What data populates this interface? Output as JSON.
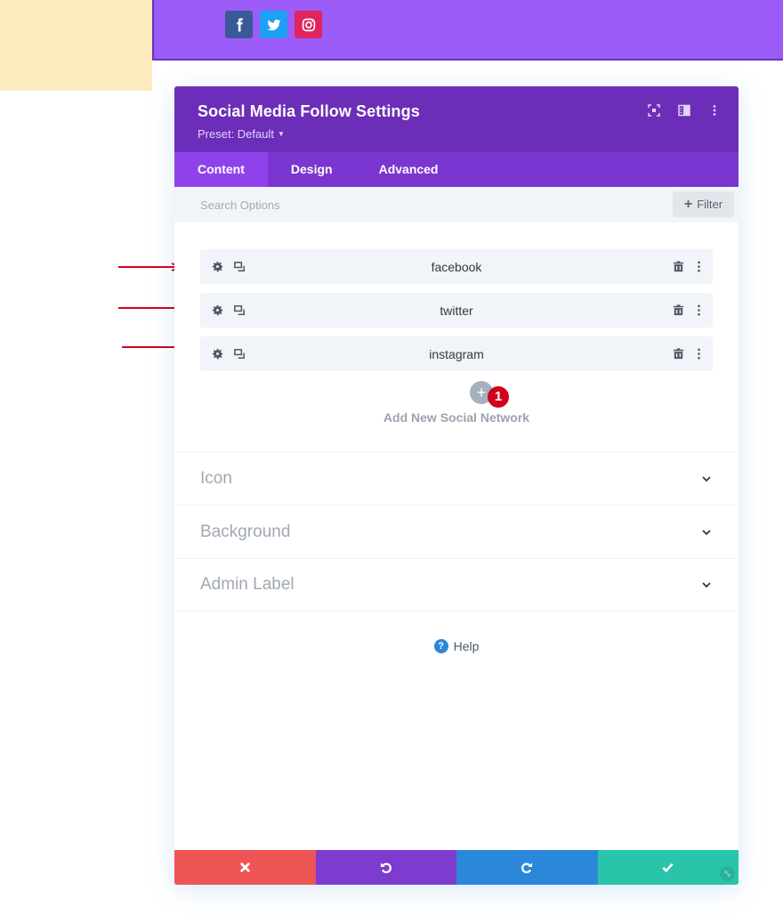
{
  "preview": {
    "social_icons": [
      {
        "name": "facebook",
        "color": "#3b5998"
      },
      {
        "name": "twitter",
        "color": "#1da1f2"
      },
      {
        "name": "instagram",
        "color": "#e0245e"
      }
    ],
    "background_color": "#9b5cf8",
    "side_block_color": "#fdecc0"
  },
  "modal": {
    "title": "Social Media Follow Settings",
    "preset": "Preset: Default",
    "header_icons": [
      "focus-icon",
      "split-view-icon",
      "more-options-icon"
    ],
    "tabs": [
      {
        "label": "Content",
        "active": true
      },
      {
        "label": "Design",
        "active": false
      },
      {
        "label": "Advanced",
        "active": false
      }
    ],
    "search": {
      "placeholder": "Search Options",
      "value": ""
    },
    "filter_label": "Filter",
    "networks": [
      {
        "label": "facebook"
      },
      {
        "label": "twitter"
      },
      {
        "label": "instagram"
      }
    ],
    "add_network": {
      "label": "Add New Social Network",
      "badge": "1"
    },
    "toggles": [
      {
        "label": "Icon"
      },
      {
        "label": "Background"
      },
      {
        "label": "Admin Label"
      }
    ],
    "help_label": "Help",
    "footer": {
      "cancel_color": "#ef5555",
      "undo_color": "#7e3bd0",
      "redo_color": "#2b87da",
      "save_color": "#29c4a9"
    }
  },
  "annotations": {
    "arrow_color": "#d0021b",
    "arrow_count": 3
  }
}
